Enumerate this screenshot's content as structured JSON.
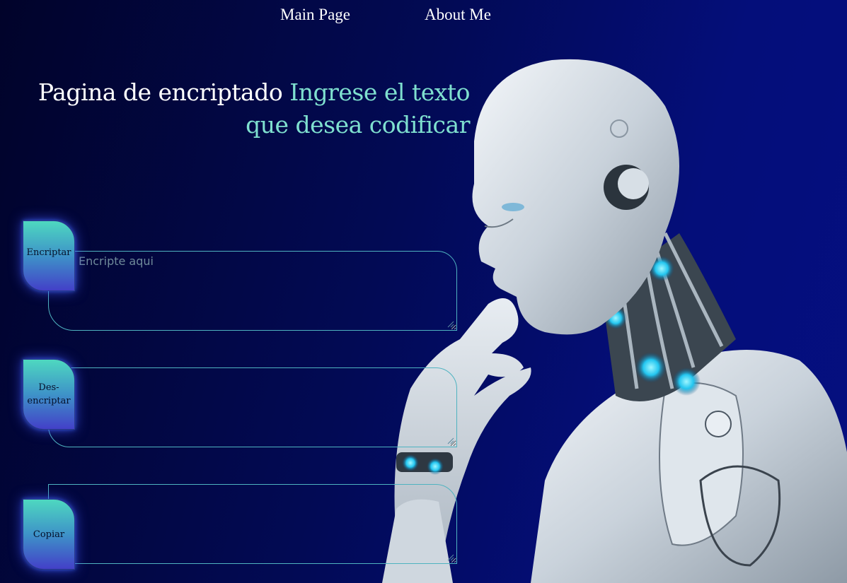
{
  "nav": {
    "main_page": "Main Page",
    "about_me": "About Me"
  },
  "heading": {
    "title": "Pagina de encriptado",
    "subtitle": "Ingrese el texto que desea codificar"
  },
  "encrypt": {
    "button_label": "Encriptar",
    "placeholder": "Encripte aqui"
  },
  "decrypt": {
    "button_label_line1": "Des-",
    "button_label_line2": "encriptar"
  },
  "copy": {
    "button_label": "Copiar"
  },
  "colors": {
    "accent": "#7fe0cf",
    "border": "#4fb3c0",
    "background": "#020a55"
  },
  "illustration": "thinking-robot-image"
}
